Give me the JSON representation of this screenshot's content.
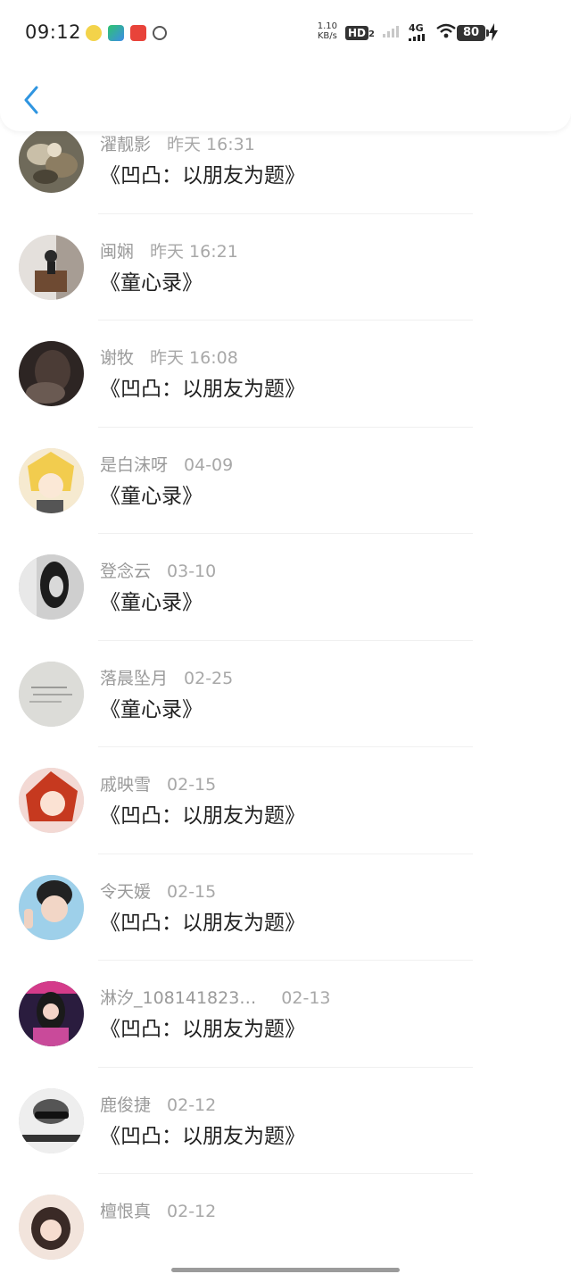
{
  "status_bar": {
    "time": "09:12",
    "net_speed_value": "1.10",
    "net_speed_unit": "KB/s",
    "hd_label": "HD",
    "hd_sub": "2",
    "network_type": "4G",
    "battery": "80"
  },
  "header": {
    "back_icon": "chevron-left-icon",
    "accent_color": "#2f95e0"
  },
  "entries": [
    {
      "name": "",
      "time": "",
      "title": ""
    },
    {
      "name": "濯靓影",
      "time": "昨天 16:31",
      "title": "《凹凸：以朋友为题》"
    },
    {
      "name": "闽娴",
      "time": "昨天 16:21",
      "title": "《童心录》"
    },
    {
      "name": "谢牧",
      "time": "昨天 16:08",
      "title": "《凹凸：以朋友为题》"
    },
    {
      "name": "是白沫呀",
      "time": "04-09",
      "title": "《童心录》"
    },
    {
      "name": "登念云",
      "time": "03-10",
      "title": "《童心录》"
    },
    {
      "name": "落晨坠月",
      "time": "02-25",
      "title": "《童心录》"
    },
    {
      "name": "戚映雪",
      "time": "02-15",
      "title": "《凹凸：以朋友为题》"
    },
    {
      "name": "令天媛",
      "time": "02-15",
      "title": "《凹凸：以朋友为题》"
    },
    {
      "name": "淋汐_108141823…",
      "time": "02-13",
      "title": "《凹凸：以朋友为题》"
    },
    {
      "name": "鹿俊捷",
      "time": "02-12",
      "title": "《凹凸：以朋友为题》"
    },
    {
      "name": "檀恨真",
      "time": "02-12",
      "title": ""
    }
  ]
}
